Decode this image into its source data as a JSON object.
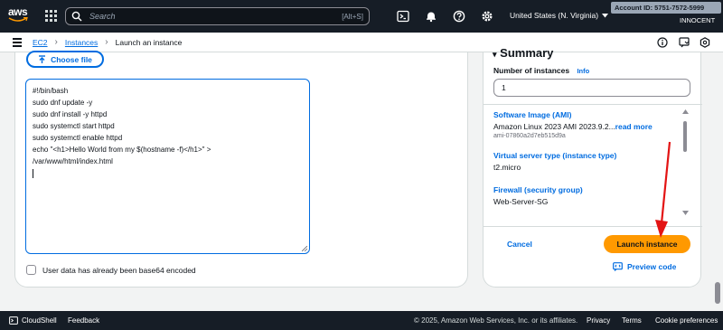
{
  "topbar": {
    "logo_text": "aws",
    "search_placeholder": "Search",
    "search_shortcut": "[Alt+S]",
    "region": "United States (N. Virginia)",
    "account": "Account ID: 5751-7572-5999",
    "user": "INNOCENT",
    "icons": [
      "apps-grid-icon",
      "search-icon",
      "cloudshell-icon",
      "bell-icon",
      "help-icon",
      "settings-icon",
      "chevron-down-icon"
    ]
  },
  "breadcrumb": {
    "items": [
      "EC2",
      "Instances",
      "Launch an instance"
    ]
  },
  "user_data": {
    "choose_file_label": "Choose file",
    "script": "#!/bin/bash\nsudo dnf update -y\nsudo dnf install -y httpd\nsudo systemctl start httpd\nsudo systemctl enable httpd\necho \"<h1>Hello World from my $(hostname -f)</h1>\" >\n/var/www/html/index.html\n",
    "base64_label": "User data has already been base64 encoded",
    "base64_checked": false
  },
  "summary": {
    "title": "Summary",
    "instances_label": "Number of instances",
    "info_label": "Info",
    "instances_value": "1",
    "software_image_title": "Software Image (AMI)",
    "software_image_value": "Amazon Linux 2023 AMI 2023.9.2...",
    "read_more": "read more",
    "ami_id": "ami-07860a2d7eb515d9a",
    "server_type_title": "Virtual server type (instance type)",
    "server_type_value": "t2.micro",
    "firewall_title": "Firewall (security group)",
    "firewall_value": "Web-Server-SG",
    "cancel_label": "Cancel",
    "launch_label": "Launch instance",
    "preview_label": "Preview code"
  },
  "footer": {
    "cloudshell": "CloudShell",
    "feedback": "Feedback",
    "copyright": "© 2025, Amazon Web Services, Inc. or its affiliates.",
    "privacy": "Privacy",
    "terms": "Terms",
    "cookies": "Cookie preferences"
  },
  "colors": {
    "nav_bg": "#161d26",
    "link": "#006ce0",
    "launch_button": "#ff9900",
    "annotation_arrow": "#e31414"
  }
}
